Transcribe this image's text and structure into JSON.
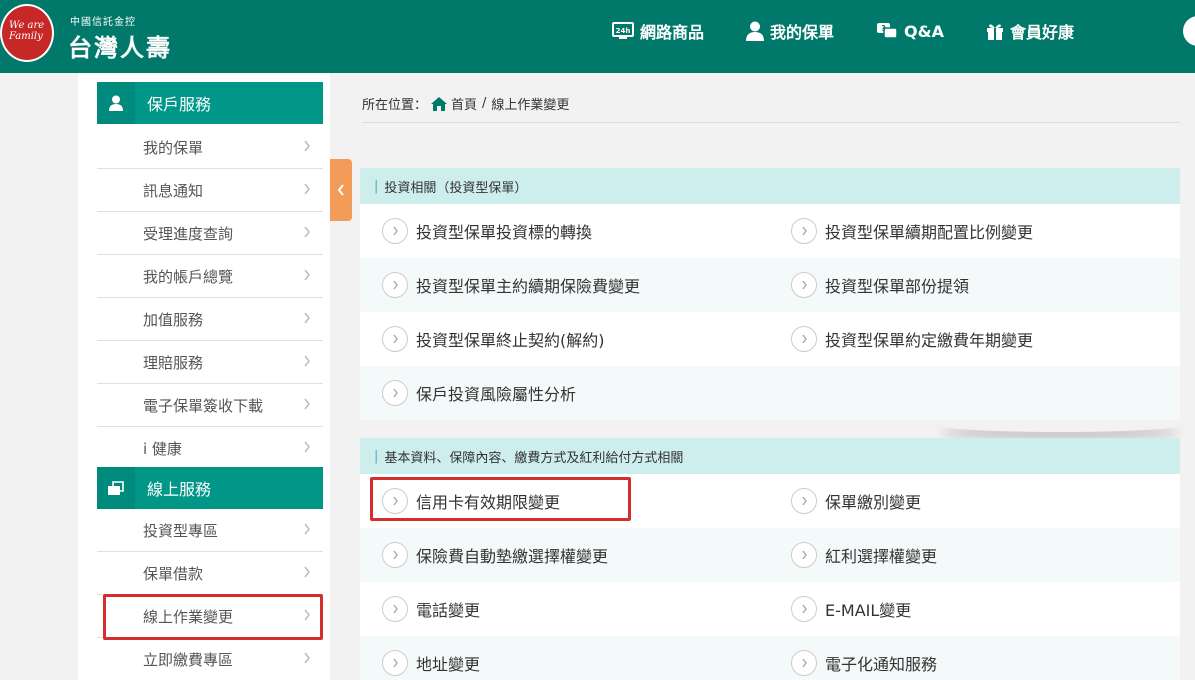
{
  "header": {
    "logo_mini": "We are Family",
    "logo_sub": "中國信託金控",
    "logo_main": "台灣人壽",
    "nav": [
      {
        "label": "網路商品",
        "icon": "24h-icon"
      },
      {
        "label": "我的保單",
        "icon": "user-icon"
      },
      {
        "label": "Q&A",
        "icon": "qa-icon"
      },
      {
        "label": "會員好康",
        "icon": "gift-icon"
      }
    ]
  },
  "sidebar": {
    "section1": {
      "title": "保戶服務",
      "icon": "user-icon"
    },
    "items1": [
      "我的保單",
      "訊息通知",
      "受理進度查詢",
      "我的帳戶總覽",
      "加值服務",
      "理賠服務",
      "電子保單簽收下載",
      "i 健康"
    ],
    "section2": {
      "title": "線上服務",
      "icon": "online-service-icon"
    },
    "items2": [
      "投資型專區",
      "保單借款",
      "線上作業變更",
      "立即繳費專區"
    ]
  },
  "breadcrumb": {
    "prefix": "所在位置：",
    "home": "首頁",
    "separator": "/",
    "current": "線上作業變更"
  },
  "panel1": {
    "title": "投資相關（投資型保單）",
    "rows": [
      [
        "投資型保單投資標的轉換",
        "投資型保單續期配置比例變更"
      ],
      [
        "投資型保單主約續期保險費變更",
        "投資型保單部份提領"
      ],
      [
        "投資型保單終止契約(解約)",
        "投資型保單約定繳費年期變更"
      ],
      [
        "保戶投資風險屬性分析",
        ""
      ]
    ]
  },
  "panel2": {
    "title": "基本資料、保障內容、繳費方式及紅利給付方式相關",
    "rows": [
      [
        "信用卡有效期限變更",
        "保單繳別變更"
      ],
      [
        "保險費自動墊繳選擇權變更",
        "紅利選擇權變更"
      ],
      [
        "電話變更",
        "E-MAIL變更"
      ],
      [
        "地址變更",
        "電子化通知服務"
      ]
    ]
  },
  "colors": {
    "header_bg": "#00796b",
    "sidebar_head": "#009688",
    "panel_head": "#cdeeed",
    "highlight": "#d32f2f",
    "collapse_tab": "#f39c5a"
  }
}
